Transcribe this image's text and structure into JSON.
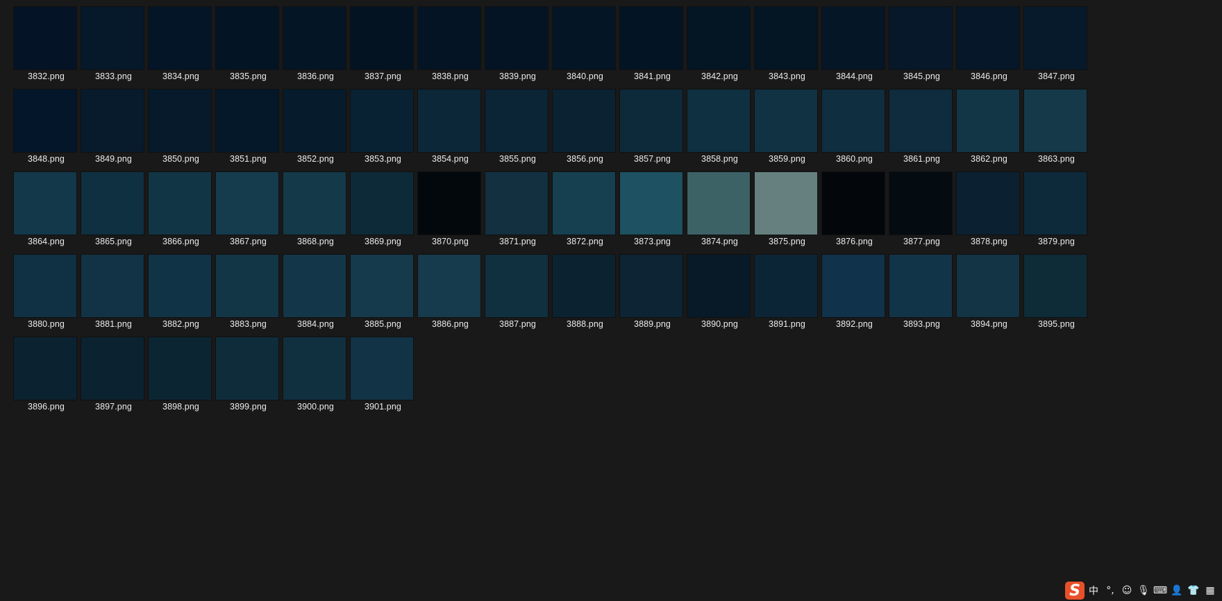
{
  "files": [
    {
      "name": "3832.png",
      "thumb": "#041426"
    },
    {
      "name": "3833.png",
      "thumb": "#06192b"
    },
    {
      "name": "3834.png",
      "thumb": "#041527"
    },
    {
      "name": "3835.png",
      "thumb": "#031424"
    },
    {
      "name": "3836.png",
      "thumb": "#041525"
    },
    {
      "name": "3837.png",
      "thumb": "#031322"
    },
    {
      "name": "3838.png",
      "thumb": "#041424"
    },
    {
      "name": "3839.png",
      "thumb": "#041424"
    },
    {
      "name": "3840.png",
      "thumb": "#041525"
    },
    {
      "name": "3841.png",
      "thumb": "#031424"
    },
    {
      "name": "3842.png",
      "thumb": "#041524"
    },
    {
      "name": "3843.png",
      "thumb": "#041524"
    },
    {
      "name": "3844.png",
      "thumb": "#051626"
    },
    {
      "name": "3845.png",
      "thumb": "#061829"
    },
    {
      "name": "3846.png",
      "thumb": "#051728"
    },
    {
      "name": "3847.png",
      "thumb": "#061a2b"
    },
    {
      "name": "3848.png",
      "thumb": "#041629"
    },
    {
      "name": "3849.png",
      "thumb": "#071b2d"
    },
    {
      "name": "3850.png",
      "thumb": "#061a2b"
    },
    {
      "name": "3851.png",
      "thumb": "#05182a"
    },
    {
      "name": "3852.png",
      "thumb": "#061b2c"
    },
    {
      "name": "3853.png",
      "thumb": "#092233"
    },
    {
      "name": "3854.png",
      "thumb": "#0c2838"
    },
    {
      "name": "3855.png",
      "thumb": "#0b2436"
    },
    {
      "name": "3856.png",
      "thumb": "#0a2232"
    },
    {
      "name": "3857.png",
      "thumb": "#0d2a3a"
    },
    {
      "name": "3858.png",
      "thumb": "#0f3040"
    },
    {
      "name": "3859.png",
      "thumb": "#113243"
    },
    {
      "name": "3860.png",
      "thumb": "#0f2e3f"
    },
    {
      "name": "3861.png",
      "thumb": "#0e2c3d"
    },
    {
      "name": "3862.png",
      "thumb": "#133646"
    },
    {
      "name": "3863.png",
      "thumb": "#153949"
    },
    {
      "name": "3864.png",
      "thumb": "#12384a"
    },
    {
      "name": "3865.png",
      "thumb": "#0f3041"
    },
    {
      "name": "3866.png",
      "thumb": "#123545"
    },
    {
      "name": "3867.png",
      "thumb": "#153c4d"
    },
    {
      "name": "3868.png",
      "thumb": "#143a4a"
    },
    {
      "name": "3869.png",
      "thumb": "#0d2a38"
    },
    {
      "name": "3870.png",
      "thumb": "#03080c"
    },
    {
      "name": "3871.png",
      "thumb": "#123040"
    },
    {
      "name": "3872.png",
      "thumb": "#164050"
    },
    {
      "name": "3873.png",
      "thumb": "#1e5162"
    },
    {
      "name": "3874.png",
      "thumb": "#3d6266"
    },
    {
      "name": "3875.png",
      "thumb": "#66807f"
    },
    {
      "name": "3876.png",
      "thumb": "#03070b"
    },
    {
      "name": "3877.png",
      "thumb": "#040b11"
    },
    {
      "name": "3878.png",
      "thumb": "#0b2030"
    },
    {
      "name": "3879.png",
      "thumb": "#0d2a3b"
    },
    {
      "name": "3880.png",
      "thumb": "#0f3143"
    },
    {
      "name": "3881.png",
      "thumb": "#113345"
    },
    {
      "name": "3882.png",
      "thumb": "#113346"
    },
    {
      "name": "3883.png",
      "thumb": "#133647"
    },
    {
      "name": "3884.png",
      "thumb": "#133748"
    },
    {
      "name": "3885.png",
      "thumb": "#143a4b"
    },
    {
      "name": "3886.png",
      "thumb": "#153b4c"
    },
    {
      "name": "3887.png",
      "thumb": "#10303f"
    },
    {
      "name": "3888.png",
      "thumb": "#0b2331"
    },
    {
      "name": "3889.png",
      "thumb": "#0c2433"
    },
    {
      "name": "3890.png",
      "thumb": "#081a27"
    },
    {
      "name": "3891.png",
      "thumb": "#0c2536"
    },
    {
      "name": "3892.png",
      "thumb": "#10324a"
    },
    {
      "name": "3893.png",
      "thumb": "#123448"
    },
    {
      "name": "3894.png",
      "thumb": "#123445"
    },
    {
      "name": "3895.png",
      "thumb": "#0e2b38"
    },
    {
      "name": "3896.png",
      "thumb": "#0b2230"
    },
    {
      "name": "3897.png",
      "thumb": "#0b2230"
    },
    {
      "name": "3898.png",
      "thumb": "#0c2533"
    },
    {
      "name": "3899.png",
      "thumb": "#0f2c3b"
    },
    {
      "name": "3900.png",
      "thumb": "#10303f"
    },
    {
      "name": "3901.png",
      "thumb": "#113345"
    }
  ],
  "ime_toolbar": {
    "logo_text": "S",
    "mode_label": "中",
    "buttons": [
      {
        "icon": "punctuation-icon",
        "glyph": "°,"
      },
      {
        "icon": "emoji-icon",
        "glyph": "☺"
      },
      {
        "icon": "microphone-icon",
        "glyph": "🎙"
      },
      {
        "icon": "keyboard-icon",
        "glyph": "⌨"
      },
      {
        "icon": "user-icon",
        "glyph": "👤"
      },
      {
        "icon": "skin-icon",
        "glyph": "👕"
      },
      {
        "icon": "apps-grid-icon",
        "glyph": "▦"
      }
    ]
  }
}
